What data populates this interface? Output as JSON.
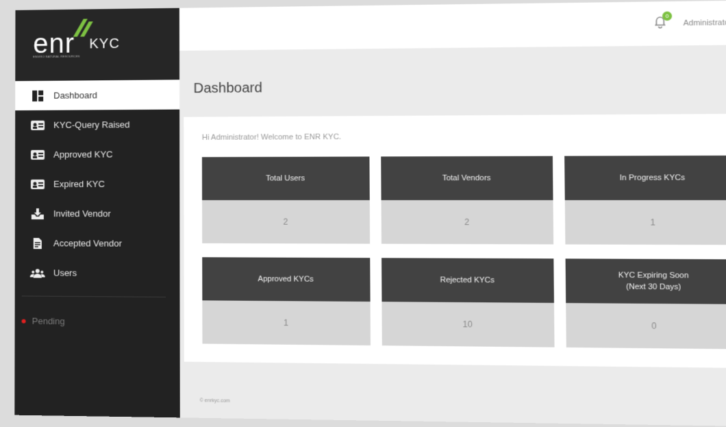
{
  "brand": {
    "logo_word": "enr",
    "logo_suffix": "KYC",
    "tagline": "ENVIRO NATURAL RESOURCES",
    "accent_color": "#7dc142"
  },
  "sidebar": {
    "items": [
      {
        "label": "Dashboard",
        "icon": "dashboard-icon",
        "active": true
      },
      {
        "label": "KYC-Query Raised",
        "icon": "kyc-card-icon"
      },
      {
        "label": "Approved KYC",
        "icon": "kyc-card-icon"
      },
      {
        "label": "Expired KYC",
        "icon": "kyc-card-icon"
      },
      {
        "label": "Invited Vendor",
        "icon": "inbox-icon"
      },
      {
        "label": "Accepted Vendor",
        "icon": "document-icon"
      },
      {
        "label": "Users",
        "icon": "users-icon"
      }
    ],
    "status_label": "Pending",
    "status_color": "#e02020"
  },
  "topbar": {
    "notification_count": "0",
    "user_name": "Administrator"
  },
  "main": {
    "title": "Dashboard",
    "welcome": "Hi Administrator! Welcome to ENR KYC.",
    "cards": [
      {
        "label": "Total Users",
        "value": "2"
      },
      {
        "label": "Total Vendors",
        "value": "2"
      },
      {
        "label": "In Progress KYCs",
        "value": "1"
      },
      {
        "label": "Approved KYCs",
        "value": "1"
      },
      {
        "label": "Rejected KYCs",
        "value": "10"
      },
      {
        "label": "KYC Expiring Soon\n(Next 30 Days)",
        "value": "0"
      }
    ]
  },
  "footer": {
    "text": "© enrkyc.com"
  }
}
